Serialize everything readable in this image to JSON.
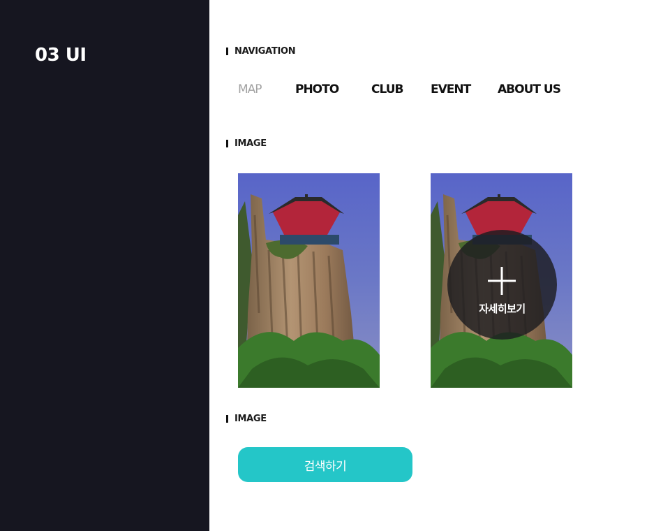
{
  "sidebar": {
    "logo": "03 UI"
  },
  "sections": {
    "navigation": "NAVIGATION",
    "image1": "IMAGE",
    "image2": "IMAGE"
  },
  "nav": {
    "items": [
      {
        "label": "MAP",
        "active": true
      },
      {
        "label": "PHOTO",
        "active": false
      },
      {
        "label": "CLUB",
        "active": false
      },
      {
        "label": "EVENT",
        "active": false
      },
      {
        "label": "ABOUT US",
        "active": false
      }
    ]
  },
  "gallery": {
    "overlay_label": "자세히보기",
    "overlay_icon": "plus-icon"
  },
  "search": {
    "button_label": "검색하기"
  },
  "colors": {
    "sidebar_bg": "#161620",
    "accent": "#24c6c8",
    "nav_active": "#a3a3a3",
    "text": "#111111"
  }
}
